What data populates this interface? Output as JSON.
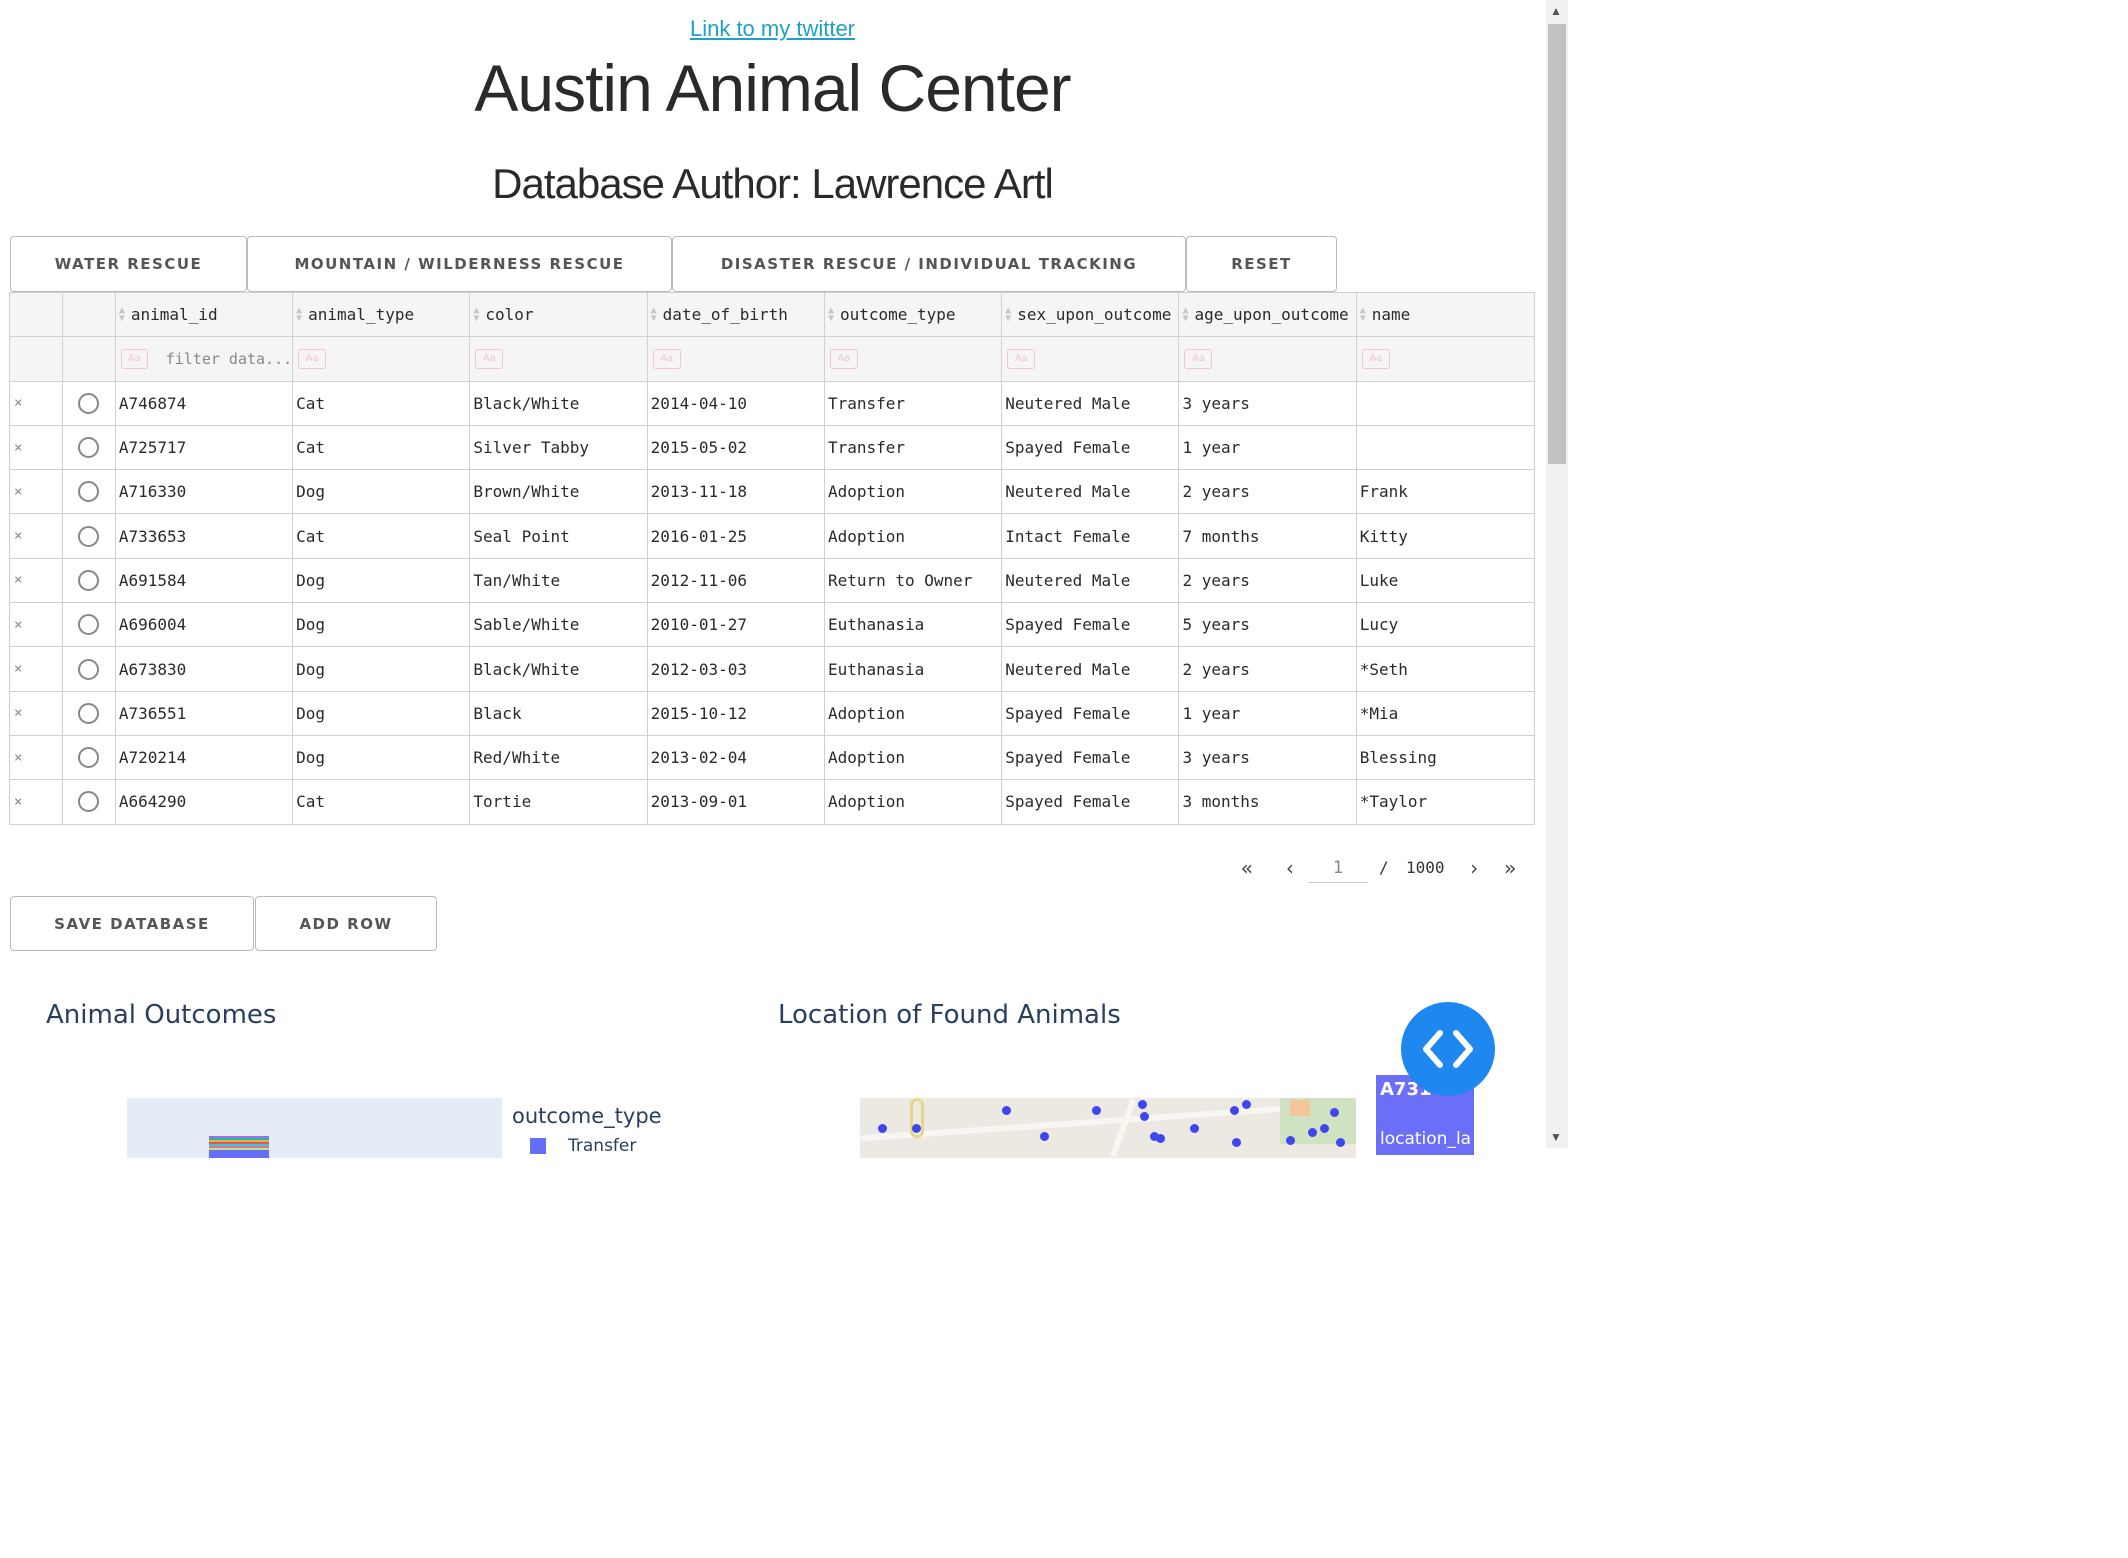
{
  "header": {
    "twitter_link": "Link to my twitter",
    "title": "Austin Animal Center",
    "subtitle": "Database Author: Lawrence Artl"
  },
  "filter_buttons": [
    {
      "label": "WATER RESCUE"
    },
    {
      "label": "MOUNTAIN / WILDERNESS RESCUE"
    },
    {
      "label": "DISASTER RESCUE / INDIVIDUAL TRACKING"
    },
    {
      "label": "RESET"
    }
  ],
  "table": {
    "columns": [
      "animal_id",
      "animal_type",
      "color",
      "date_of_birth",
      "outcome_type",
      "sex_upon_outcome",
      "age_upon_outcome",
      "name"
    ],
    "filter_placeholder": "filter data...",
    "filter_badge": "Aa",
    "delete_glyph": "×",
    "rows": [
      [
        "A746874",
        "Cat",
        "Black/White",
        "2014-04-10",
        "Transfer",
        "Neutered Male",
        "3 years",
        ""
      ],
      [
        "A725717",
        "Cat",
        "Silver Tabby",
        "2015-05-02",
        "Transfer",
        "Spayed Female",
        "1 year",
        ""
      ],
      [
        "A716330",
        "Dog",
        "Brown/White",
        "2013-11-18",
        "Adoption",
        "Neutered Male",
        "2 years",
        "Frank"
      ],
      [
        "A733653",
        "Cat",
        "Seal Point",
        "2016-01-25",
        "Adoption",
        "Intact Female",
        "7 months",
        "Kitty"
      ],
      [
        "A691584",
        "Dog",
        "Tan/White",
        "2012-11-06",
        "Return to Owner",
        "Neutered Male",
        "2 years",
        "Luke"
      ],
      [
        "A696004",
        "Dog",
        "Sable/White",
        "2010-01-27",
        "Euthanasia",
        "Spayed Female",
        "5 years",
        "Lucy"
      ],
      [
        "A673830",
        "Dog",
        "Black/White",
        "2012-03-03",
        "Euthanasia",
        "Neutered Male",
        "2 years",
        "*Seth"
      ],
      [
        "A736551",
        "Dog",
        "Black",
        "2015-10-12",
        "Adoption",
        "Spayed Female",
        "1 year",
        "*Mia"
      ],
      [
        "A720214",
        "Dog",
        "Red/White",
        "2013-02-04",
        "Adoption",
        "Spayed Female",
        "3 years",
        "Blessing"
      ],
      [
        "A664290",
        "Cat",
        "Tortie",
        "2013-09-01",
        "Adoption",
        "Spayed Female",
        "3 months",
        "*Taylor"
      ]
    ]
  },
  "pagination": {
    "first": "«",
    "prev": "‹",
    "current_page": "1",
    "separator": "/",
    "total_pages": "1000",
    "next": "›",
    "last": "»"
  },
  "actions": {
    "save_label": "SAVE DATABASE",
    "add_row_label": "ADD ROW"
  },
  "charts": {
    "outcomes_title": "Animal Outcomes",
    "legend_title": "outcome_type",
    "legend_first_item": "Transfer",
    "map_title": "Location of Found Animals"
  },
  "map_tooltip": {
    "id_text": "A731",
    "label_text": "location_la"
  },
  "colors": {
    "link": "#1ea0c8",
    "accent_fab": "#1e88f0",
    "map_marker": "#3f46ee",
    "legend_transfer": "#636efa",
    "tooltip_bg": "#6b6ef7"
  },
  "icons": {
    "fab": "code-brackets-icon",
    "sort": "sort-arrows-icon",
    "row_select": "radio-icon",
    "row_delete": "close-icon"
  }
}
